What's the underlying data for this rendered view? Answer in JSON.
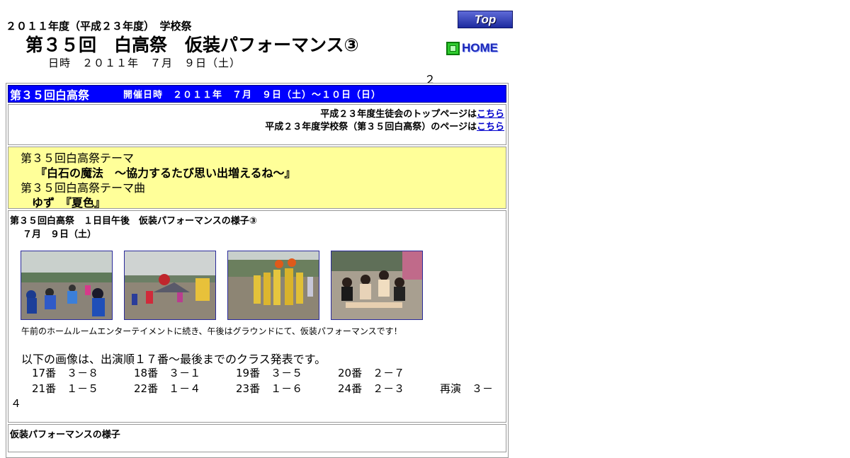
{
  "page": {
    "pre_title": "２０１１年度（平成２３年度）　学校祭",
    "main_title": "第３５回　白高祭　仮装パフォーマンス③",
    "date_line": "日時　２０１１年　７月　９日（土）",
    "stray_char": "２"
  },
  "nav": {
    "top_label": "Top",
    "home_label": "HOME"
  },
  "header_bar": {
    "title": "第３５回白高祭",
    "dates": "開催日時　２０１１年　７月　９日（土）～１０日（日）"
  },
  "links": [
    {
      "text": "平成２３年度生徒会のトップページは",
      "link": "こちら"
    },
    {
      "text": "平成２３年度学校祭（第３５回白高祭）のページは",
      "link": "こちら"
    }
  ],
  "theme": {
    "theme_label": "第３５回白高祭テーマ",
    "theme_text": "『白石の魔法　～協力するたび思い出増えるね～』",
    "song_label": "第３５回白高祭テーマ曲",
    "song_text": "ゆず　『夏色』"
  },
  "performance": {
    "title": "第３５回白高祭　１日目午後　仮装パフォーマンスの様子③",
    "date": "７月　９日（土）",
    "caption": "午前のホームルームエンターテイメントに続き、午後はグラウンドにて、仮装パフォーマンスです！",
    "intro": "以下の画像は、出演順１７番～最後までのクラス発表です。",
    "order_rows": [
      [
        "17番　３－８",
        "18番　３－１",
        "19番　３－５",
        "20番　２－７"
      ],
      [
        "21番　１－５",
        "22番　１－４",
        "23番　１－６",
        "24番　２－３",
        "再演　３－"
      ]
    ],
    "wrap_tail": "４"
  },
  "section2": {
    "title": "仮装パフォーマンスの様子"
  },
  "colors": {
    "header_bg": "#0000ff",
    "theme_bg": "#ffff99",
    "link": "#0000cc"
  }
}
